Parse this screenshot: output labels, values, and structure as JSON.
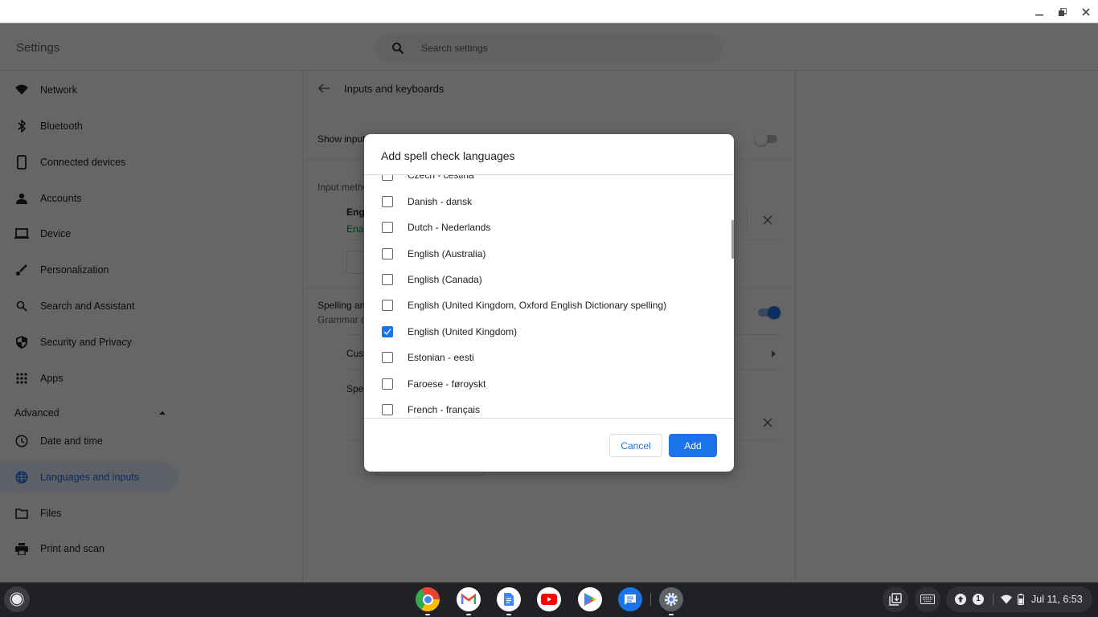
{
  "window": {
    "controls": {
      "minimize": "minimize",
      "restore": "restore",
      "close": "close"
    }
  },
  "header": {
    "title": "Settings",
    "search": {
      "placeholder": "Search settings",
      "icon": "search-icon"
    }
  },
  "sidebar": {
    "items": [
      {
        "label": "Network",
        "icon": "wifi-icon"
      },
      {
        "label": "Bluetooth",
        "icon": "bluetooth-icon"
      },
      {
        "label": "Connected devices",
        "icon": "phone-icon"
      },
      {
        "label": "Accounts",
        "icon": "person-icon"
      },
      {
        "label": "Device",
        "icon": "laptop-icon"
      },
      {
        "label": "Personalization",
        "icon": "brush-icon"
      },
      {
        "label": "Search and Assistant",
        "icon": "search-icon"
      },
      {
        "label": "Security and Privacy",
        "icon": "shield-icon"
      },
      {
        "label": "Apps",
        "icon": "apps-grid-icon"
      }
    ],
    "advanced": {
      "label": "Advanced",
      "expanded": true,
      "items": [
        {
          "label": "Date and time",
          "icon": "clock-icon"
        },
        {
          "label": "Languages and inputs",
          "icon": "globe-icon",
          "active": true
        },
        {
          "label": "Files",
          "icon": "folder-icon"
        },
        {
          "label": "Print and scan",
          "icon": "printer-icon"
        }
      ]
    }
  },
  "main": {
    "page_title": "Inputs and keyboards",
    "show_input_label": "Show input",
    "show_input_enabled": false,
    "input_methods_label": "Input metho",
    "input_method_name": "Engl",
    "input_method_status": "Enab",
    "spelling_label": "Spelling an",
    "spelling_sublabel": "Grammar c",
    "spelling_enabled": true,
    "custom_label": "Cust",
    "spell_label": "Spel"
  },
  "dialog": {
    "title": "Add spell check languages",
    "languages": [
      {
        "label": "Czech - čeština",
        "checked": false
      },
      {
        "label": "Danish - dansk",
        "checked": false
      },
      {
        "label": "Dutch - Nederlands",
        "checked": false
      },
      {
        "label": "English (Australia)",
        "checked": false
      },
      {
        "label": "English (Canada)",
        "checked": false
      },
      {
        "label": "English (United Kingdom, Oxford English Dictionary spelling)",
        "checked": false
      },
      {
        "label": "English (United Kingdom)",
        "checked": true
      },
      {
        "label": "Estonian - eesti",
        "checked": false
      },
      {
        "label": "Faroese - føroyskt",
        "checked": false
      },
      {
        "label": "French - français",
        "checked": false
      }
    ],
    "cancel_label": "Cancel",
    "add_label": "Add"
  },
  "shelf": {
    "apps": [
      {
        "name": "Chrome",
        "running": true
      },
      {
        "name": "Gmail",
        "running": true
      },
      {
        "name": "Docs",
        "running": true
      },
      {
        "name": "YouTube",
        "running": false
      },
      {
        "name": "Play Store",
        "running": false
      },
      {
        "name": "Messages",
        "running": false
      },
      {
        "name": "Settings",
        "running": true
      }
    ],
    "tray": {
      "notification_count": "1",
      "time": "Jul 11, 6:53"
    }
  },
  "colors": {
    "accent": "#1a73e8",
    "enabled_green": "#188038"
  }
}
